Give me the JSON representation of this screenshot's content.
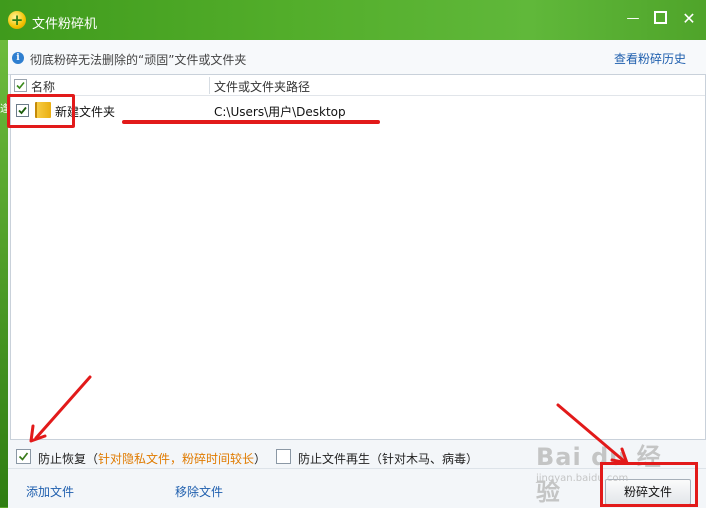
{
  "window": {
    "title": "文件粉碎机",
    "app_icon_glyph": "+",
    "minimize_glyph": "—",
    "close_glyph": "✕",
    "side_char": "逢"
  },
  "infobar": {
    "text": "彻底粉碎无法删除的“顽固”文件或文件夹",
    "icon_glyph": "i",
    "history_link": "查看粉碎历史"
  },
  "list": {
    "columns": {
      "name": "名称",
      "path": "文件或文件夹路径"
    },
    "header_checked": true,
    "rows": [
      {
        "checked": true,
        "name": "新建文件夹",
        "path": "C:\\Users\\用户\\Desktop",
        "icon": "folder-icon"
      }
    ]
  },
  "options": {
    "prevent_recovery_checked": true,
    "prevent_recovery_label": "防止恢复（",
    "prevent_recovery_hint": "针对隐私文件，粉碎时间较长",
    "prevent_recovery_close": "）",
    "prevent_regen_checked": false,
    "prevent_regen_label": "防止文件再生（针对木马、病毒）"
  },
  "footer": {
    "add_files": "添加文件",
    "remove_files": "移除文件",
    "shred_button": "粉碎文件"
  },
  "watermark": {
    "main": "Bai du 经验",
    "sub": "jingyan.baidu.com"
  },
  "colors": {
    "window_green": "#4e9e28",
    "annotation_red": "#e21a1a",
    "link_blue": "#1f5fae",
    "hint_orange": "#e07b00"
  }
}
